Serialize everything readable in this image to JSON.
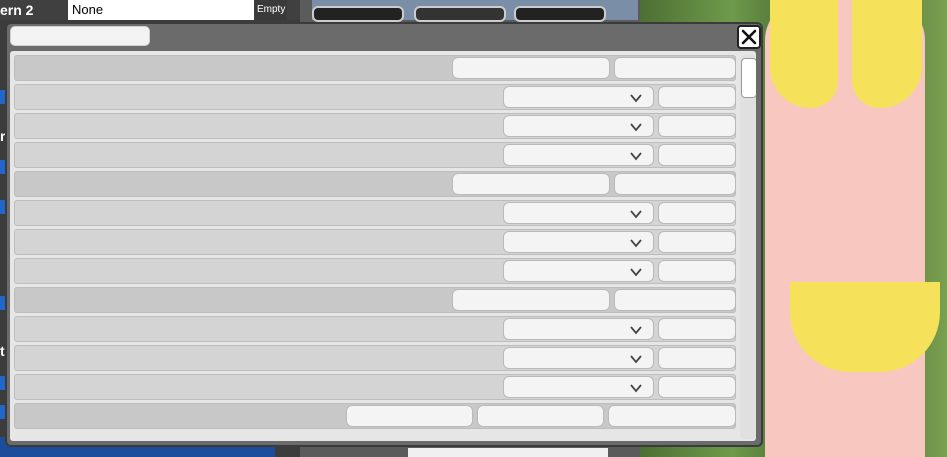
{
  "background": {
    "left_panel": {
      "label": "ern 2",
      "field_value": "None",
      "empty_label": "Empty",
      "letters": [
        "r",
        "t"
      ]
    }
  },
  "dialog": {
    "title_value": "",
    "close_icon": "close-icon",
    "rows": [
      {
        "kind": "header",
        "buttons": 2
      },
      {
        "kind": "item"
      },
      {
        "kind": "item"
      },
      {
        "kind": "item"
      },
      {
        "kind": "header",
        "buttons": 2
      },
      {
        "kind": "item"
      },
      {
        "kind": "item"
      },
      {
        "kind": "item"
      },
      {
        "kind": "header",
        "buttons": 2
      },
      {
        "kind": "item"
      },
      {
        "kind": "item"
      },
      {
        "kind": "item"
      },
      {
        "kind": "header",
        "buttons": 3
      }
    ],
    "scroll_position": 0.0
  },
  "colors": {
    "dialog_frame": "#6b6b6b",
    "row_bg": "#d4d4d4",
    "header_bg": "#c8c8c8",
    "bikini": "#f5e15a",
    "accent_blue": "#2266cc"
  }
}
